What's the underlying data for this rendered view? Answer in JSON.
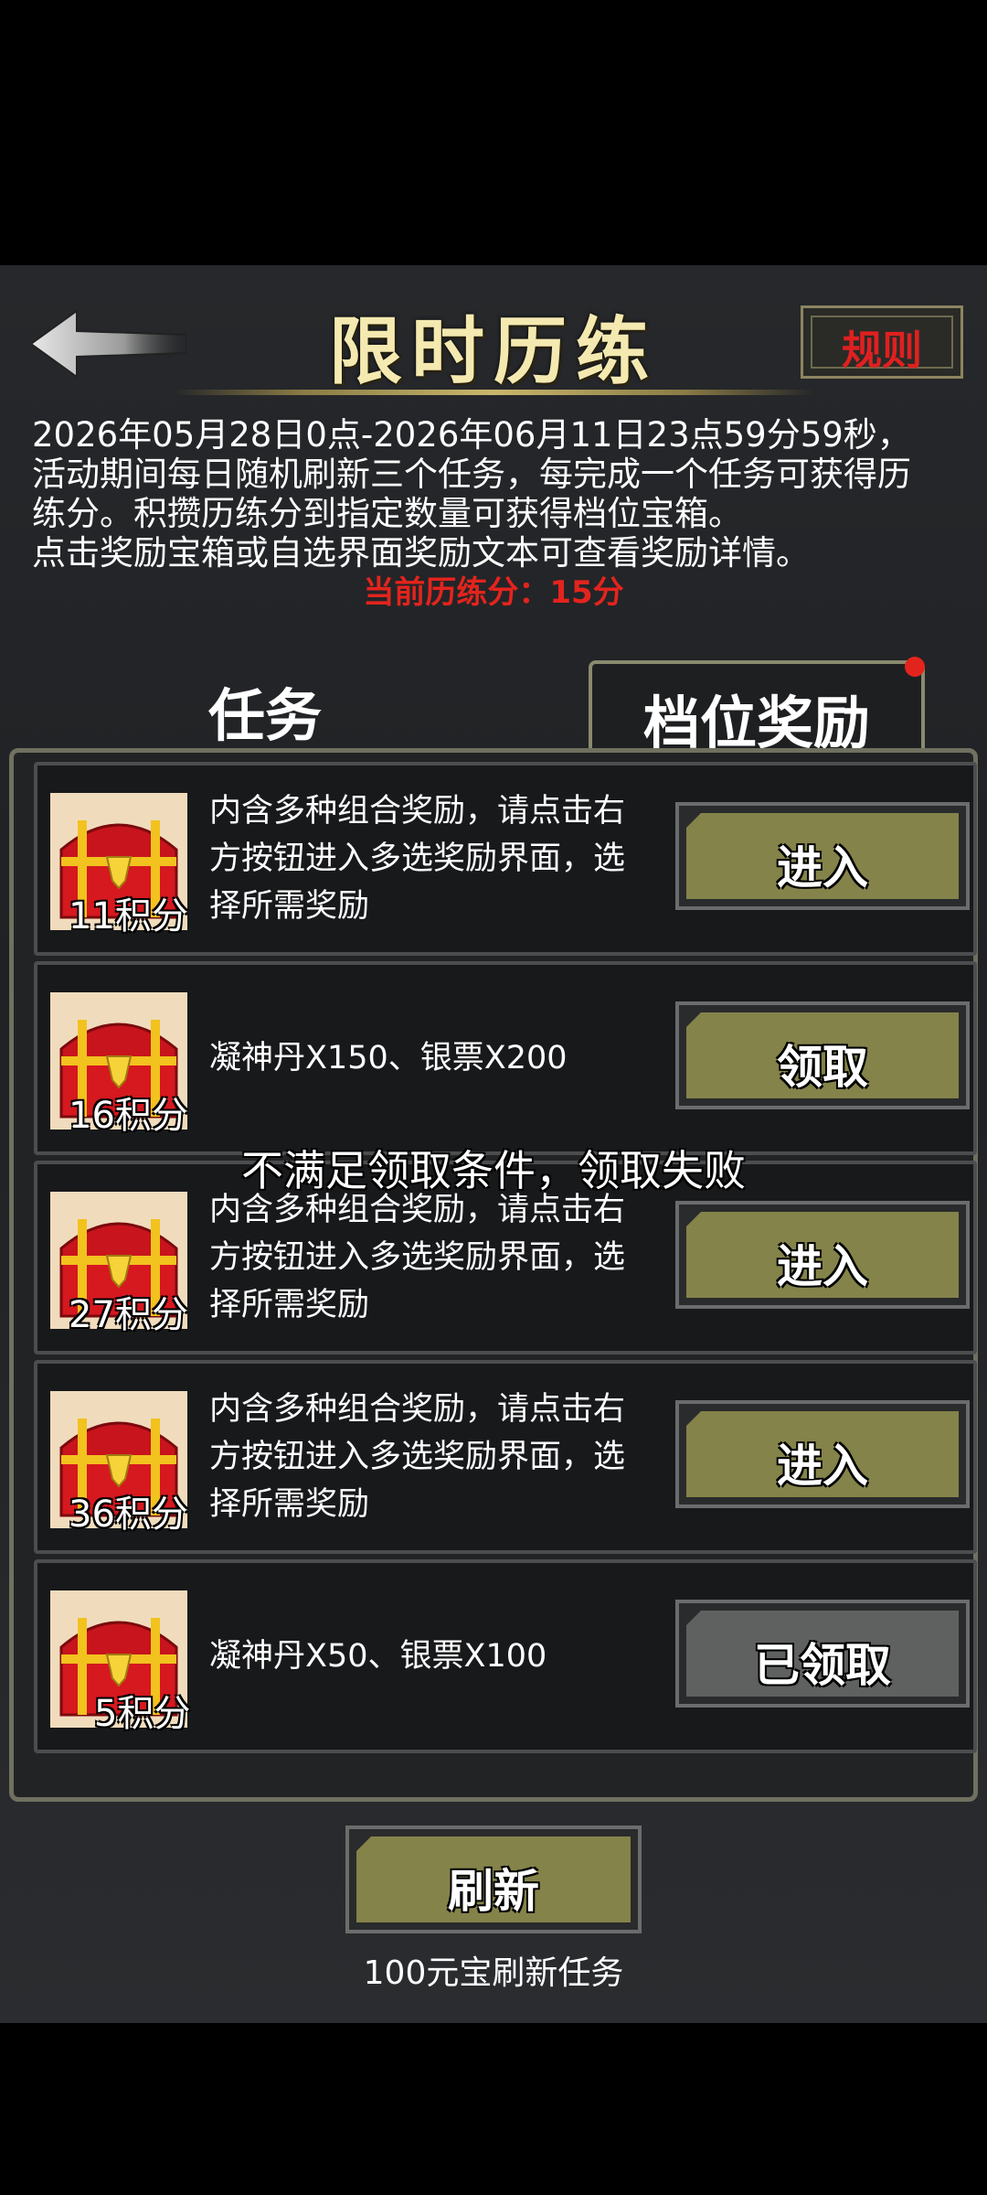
{
  "header": {
    "title": "限时历练",
    "rules_label": "规则"
  },
  "description": {
    "lines": [
      "2026年05月28日0点-2026年06月11日23点59分59秒，",
      "活动期间每日随机刷新三个任务，每完成一个任务可获得历",
      "练分。积攒历练分到指定数量可获得档位宝箱。",
      "点击奖励宝箱或自选界面奖励文本可查看奖励详情。"
    ],
    "score": "当前历练分：15分"
  },
  "tabs": {
    "task": "任务",
    "reward": "档位奖励",
    "active": "reward"
  },
  "rewards": [
    {
      "points": "11积分",
      "lines": [
        "内含多种组合奖励，请点击右",
        "方按钮进入多选奖励界面，选",
        "择所需奖励"
      ],
      "button": "进入",
      "state": "enter"
    },
    {
      "points": "16积分",
      "lines": [
        "凝神丹X150、银票X200"
      ],
      "button": "领取",
      "state": "claim"
    },
    {
      "points": "27积分",
      "lines": [
        "内含多种组合奖励，请点击右",
        "方按钮进入多选奖励界面，选",
        "择所需奖励"
      ],
      "button": "进入",
      "state": "enter"
    },
    {
      "points": "36积分",
      "lines": [
        "内含多种组合奖励，请点击右",
        "方按钮进入多选奖励界面，选",
        "择所需奖励"
      ],
      "button": "进入",
      "state": "enter"
    },
    {
      "points": "5积分",
      "lines": [
        "凝神丹X50、银票X100"
      ],
      "button": "已领取",
      "state": "claimed"
    }
  ],
  "toast": "不满足领取条件，领取失败",
  "footer": {
    "refresh_label": "刷新",
    "refresh_cost": "100元宝刷新任务"
  },
  "colors": {
    "accent_button": "#84834a",
    "claimed_button": "#5f6060",
    "score_text": "#e3241d",
    "title_text": "#f4e9b0"
  },
  "icons": [
    "back-arrow-icon",
    "treasure-chest-icon",
    "notification-dot-icon"
  ]
}
